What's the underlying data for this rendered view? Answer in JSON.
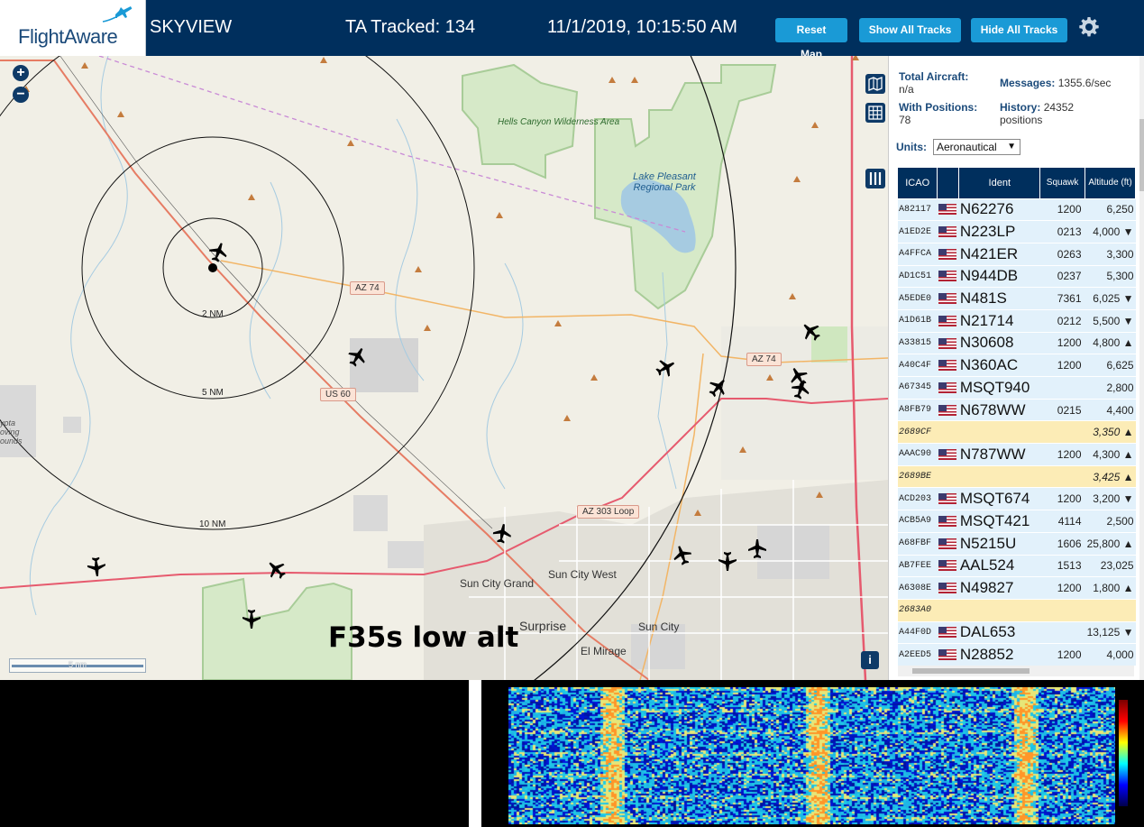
{
  "header": {
    "logo_text": "FlightAware",
    "site_name": "SKYVIEW",
    "tracked_label": "TA Tracked: 134",
    "datetime": "11/1/2019, 10:15:50 AM",
    "buttons": {
      "reset": "Reset Map",
      "show_all": "Show All Tracks",
      "hide_all": "Hide All Tracks"
    },
    "settings_icon": "gear-icon"
  },
  "map": {
    "rings": [
      "2 NM",
      "5 NM",
      "10 NM"
    ],
    "zoom_in": "+",
    "zoom_out": "−",
    "scale": "5 nm",
    "annotation": "F35s low alt",
    "labels": {
      "wilderness": "Hells Canyon Wilderness Area",
      "lake": "Lake Pleasant Regional Park",
      "sun_city_grand": "Sun City Grand",
      "sun_city_west": "Sun City West",
      "surprise": "Surprise",
      "sun_city": "Sun City",
      "el_mirage": "El Mirage",
      "proving": "yota oving ounds"
    },
    "road_shields": {
      "az74_a": "AZ 74",
      "az74_b": "AZ 74",
      "us60": "US 60",
      "az303": "AZ 303 Loop"
    },
    "info_icon": "i"
  },
  "sidebar": {
    "total_aircraft_label": "Total Aircraft:",
    "total_aircraft_value": "n/a",
    "with_positions_label": "With Positions:",
    "with_positions_value": "78",
    "messages_label": "Messages:",
    "messages_value": "1355.6/sec",
    "history_label": "History:",
    "history_value": "24352 positions",
    "units_label": "Units:",
    "units_value": "Aeronautical",
    "columns": [
      "ICAO",
      "",
      "Ident",
      "Squawk",
      "Altitude (ft)"
    ],
    "rows": [
      {
        "icao": "A82117",
        "flag": true,
        "ident": "N62276",
        "squawk": "1200",
        "alt": "6,250",
        "mlat": false
      },
      {
        "icao": "A1ED2E",
        "flag": true,
        "ident": "N223LP",
        "squawk": "0213",
        "alt": "4,000 ▼",
        "mlat": false
      },
      {
        "icao": "A4FFCA",
        "flag": true,
        "ident": "N421ER",
        "squawk": "0263",
        "alt": "3,300",
        "mlat": false
      },
      {
        "icao": "AD1C51",
        "flag": true,
        "ident": "N944DB",
        "squawk": "0237",
        "alt": "5,300",
        "mlat": false
      },
      {
        "icao": "A5EDE0",
        "flag": true,
        "ident": "N481S",
        "squawk": "7361",
        "alt": "6,025 ▼",
        "mlat": false
      },
      {
        "icao": "A1D61B",
        "flag": true,
        "ident": "N21714",
        "squawk": "0212",
        "alt": "5,500 ▼",
        "mlat": false
      },
      {
        "icao": "A33815",
        "flag": true,
        "ident": "N30608",
        "squawk": "1200",
        "alt": "4,800 ▲",
        "mlat": false
      },
      {
        "icao": "A40C4F",
        "flag": true,
        "ident": "N360AC",
        "squawk": "1200",
        "alt": "6,625",
        "mlat": false
      },
      {
        "icao": "A67345",
        "flag": true,
        "ident": "MSQT940",
        "squawk": "",
        "alt": "2,800",
        "mlat": false
      },
      {
        "icao": "A8FB79",
        "flag": true,
        "ident": "N678WW",
        "squawk": "0215",
        "alt": "4,400",
        "mlat": false
      },
      {
        "icao": "2689CF",
        "flag": false,
        "ident": "",
        "squawk": "",
        "alt": "3,350 ▲",
        "mlat": true
      },
      {
        "icao": "AAAC90",
        "flag": true,
        "ident": "N787WW",
        "squawk": "1200",
        "alt": "4,300 ▲",
        "mlat": false
      },
      {
        "icao": "2689BE",
        "flag": false,
        "ident": "",
        "squawk": "",
        "alt": "3,425 ▲",
        "mlat": true
      },
      {
        "icao": "ACD203",
        "flag": true,
        "ident": "MSQT674",
        "squawk": "1200",
        "alt": "3,200 ▼",
        "mlat": false
      },
      {
        "icao": "ACB5A9",
        "flag": true,
        "ident": "MSQT421",
        "squawk": "4114",
        "alt": "2,500",
        "mlat": false
      },
      {
        "icao": "A68FBF",
        "flag": true,
        "ident": "N5215U",
        "squawk": "1606",
        "alt": "25,800 ▲",
        "mlat": false
      },
      {
        "icao": "AB7FEE",
        "flag": true,
        "ident": "AAL524",
        "squawk": "1513",
        "alt": "23,025",
        "mlat": false
      },
      {
        "icao": "A6308E",
        "flag": true,
        "ident": "N49827",
        "squawk": "1200",
        "alt": "1,800 ▲",
        "mlat": false
      },
      {
        "icao": "2683A0",
        "flag": false,
        "ident": "",
        "squawk": "",
        "alt": "",
        "mlat": true
      },
      {
        "icao": "A44F0D",
        "flag": true,
        "ident": "DAL653",
        "squawk": "",
        "alt": "13,125 ▼",
        "mlat": false
      },
      {
        "icao": "A2EED5",
        "flag": true,
        "ident": "N28852",
        "squawk": "1200",
        "alt": "4,000",
        "mlat": false
      }
    ]
  }
}
